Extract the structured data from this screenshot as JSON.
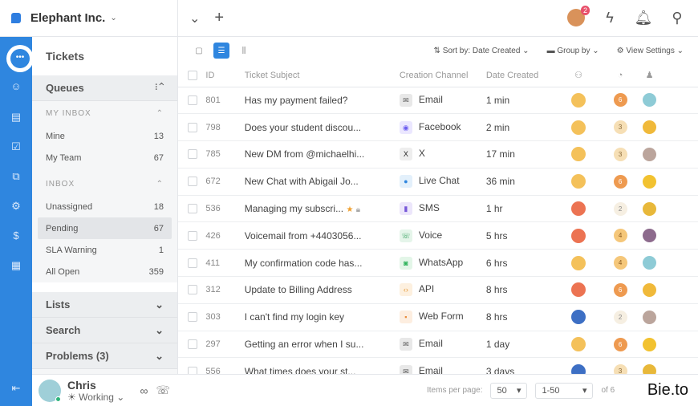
{
  "header": {
    "org": "Elephant Inc.",
    "notif_count": "2"
  },
  "sidebar": {
    "title": "Tickets",
    "queues": "Queues",
    "my_inbox": "MY INBOX",
    "inbox": "INBOX",
    "my_items": [
      {
        "label": "Mine",
        "count": "13"
      },
      {
        "label": "My Team",
        "count": "67"
      }
    ],
    "inbox_items": [
      {
        "label": "Unassigned",
        "count": "18"
      },
      {
        "label": "Pending",
        "count": "67"
      },
      {
        "label": "SLA Warning",
        "count": "1"
      },
      {
        "label": "All Open",
        "count": "359"
      }
    ],
    "lists": "Lists",
    "search": "Search",
    "problems": "Problems (3)",
    "user": {
      "name": "Chris",
      "status": "Working"
    }
  },
  "toolbar": {
    "sort": "Sort by: Date Created",
    "group": "Group by",
    "view": "View Settings"
  },
  "columns": {
    "id": "ID",
    "subject": "Ticket Subject",
    "channel": "Creation Channel",
    "date": "Date Created"
  },
  "rows": [
    {
      "id": "801",
      "subject": "Has my payment failed?",
      "channel": "Email",
      "date": "1 min",
      "status": "#f4c15a",
      "priority": "6",
      "assignee": "#8ecbd6"
    },
    {
      "id": "798",
      "subject": "Does your student discou...",
      "channel": "Facebook",
      "date": "2 min",
      "status": "#f4c15a",
      "priority": "3",
      "assignee": "#f0b93a"
    },
    {
      "id": "785",
      "subject": "New DM from @michaelhi...",
      "channel": "X",
      "date": "17 min",
      "status": "#f4c15a",
      "priority": "3",
      "assignee": "#bba59c"
    },
    {
      "id": "672",
      "subject": "New Chat with Abigail Jo...",
      "channel": "Live Chat",
      "date": "36 min",
      "status": "#f4c15a",
      "priority": "6",
      "assignee": "#f2c230"
    },
    {
      "id": "536",
      "subject": "Managing my subscri...",
      "channel": "SMS",
      "date": "1 hr",
      "status": "#ec7352",
      "priority": "2",
      "assignee": "#e8b83a",
      "flags": true
    },
    {
      "id": "426",
      "subject": "Voicemail from +4403056...",
      "channel": "Voice",
      "date": "5 hrs",
      "status": "#ec7352",
      "priority": "4",
      "assignee": "#8d6b8d"
    },
    {
      "id": "411",
      "subject": "My confirmation code has...",
      "channel": "WhatsApp",
      "date": "6 hrs",
      "status": "#f4c15a",
      "priority": "4",
      "assignee": "#8ecbd6"
    },
    {
      "id": "312",
      "subject": "Update to Billing Address",
      "channel": "API",
      "date": "8 hrs",
      "status": "#ec7352",
      "priority": "6",
      "assignee": "#f0b93a"
    },
    {
      "id": "303",
      "subject": "I can't find my login key",
      "channel": "Web Form",
      "date": "8 hrs",
      "status": "#3d6fc4",
      "priority": "2",
      "assignee": "#bba59c"
    },
    {
      "id": "297",
      "subject": "Getting an error when I su...",
      "channel": "Email",
      "date": "1 day",
      "status": "#f4c15a",
      "priority": "6",
      "assignee": "#f2c230"
    },
    {
      "id": "556",
      "subject": "What times does your st...",
      "channel": "Email",
      "date": "3 days",
      "status": "#3d6fc4",
      "priority": "3",
      "assignee": "#e8b83a"
    }
  ],
  "footer": {
    "items_label": "Items per page:",
    "per_page": "50",
    "range": "1-50",
    "of": "of 6"
  },
  "watermark": "Bie.to",
  "colors": {
    "accent": "#2f86df"
  }
}
